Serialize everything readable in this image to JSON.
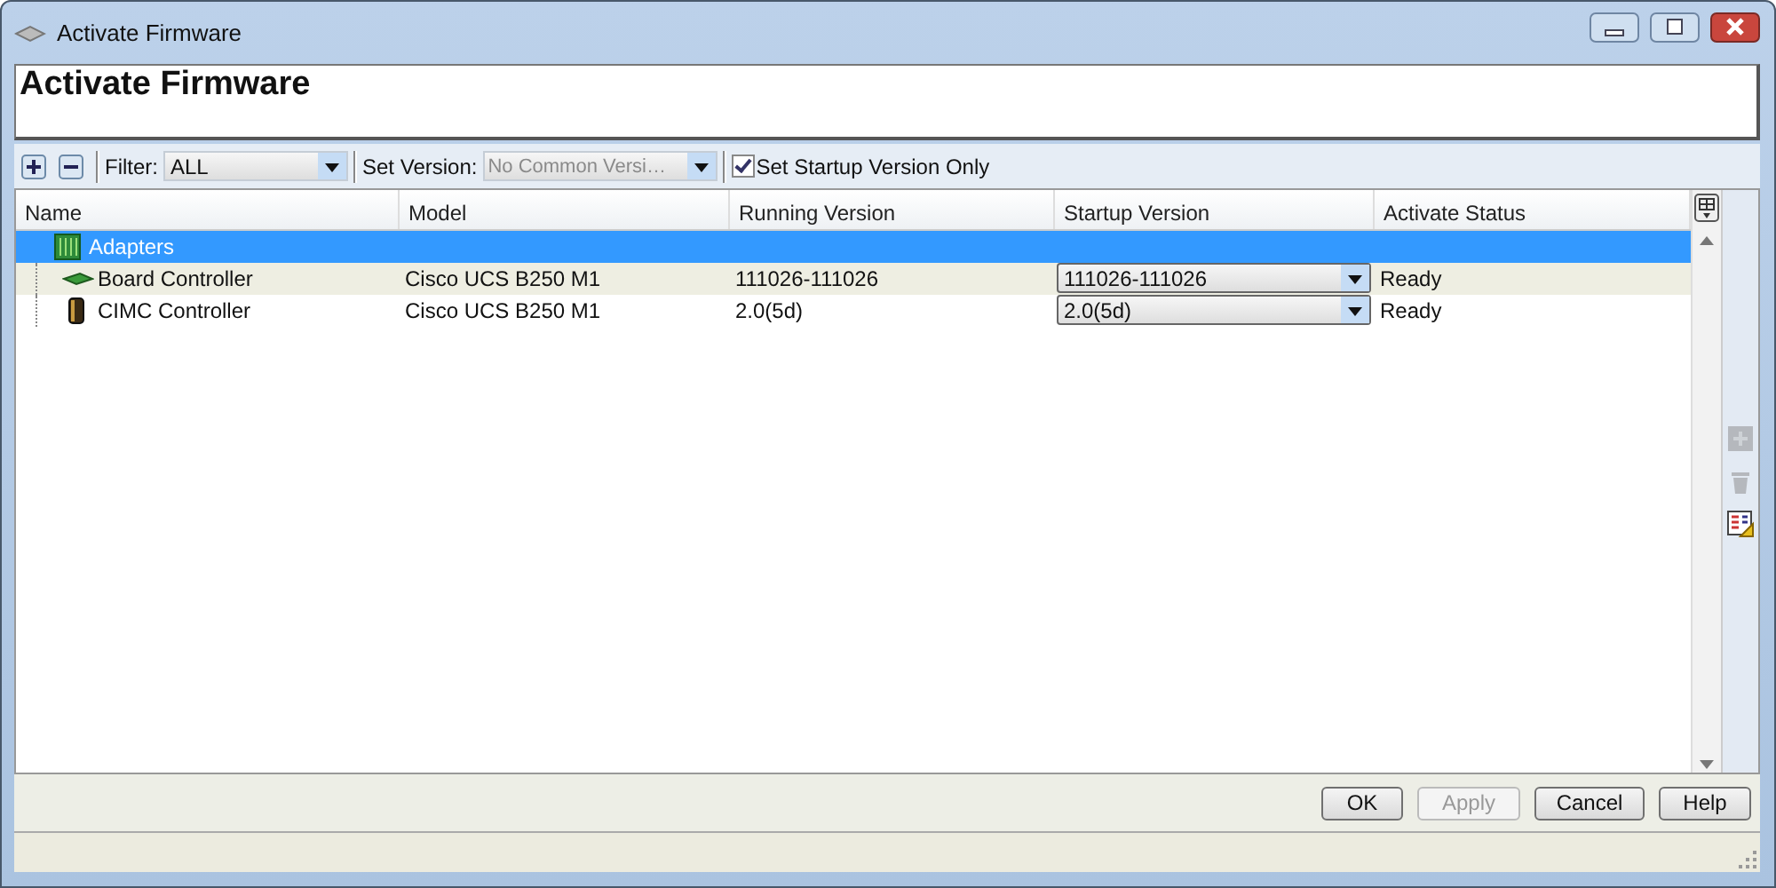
{
  "window": {
    "title": "Activate Firmware"
  },
  "header": {
    "title": "Activate Firmware"
  },
  "toolbar": {
    "filter": {
      "label": "Filter:",
      "value": "ALL"
    },
    "set_version": {
      "label": "Set Version:",
      "value": "No Common Versi…",
      "disabled": true
    },
    "startup_only": {
      "label": "Set Startup Version Only",
      "checked": true
    }
  },
  "table": {
    "columns": [
      "Name",
      "Model",
      "Running Version",
      "Startup Version",
      "Activate Status"
    ],
    "rows": [
      {
        "name": "Adapters",
        "kind": "adapter",
        "selected": true,
        "children": [
          {
            "name": "Board Controller",
            "kind": "board",
            "model": "Cisco UCS B250 M1",
            "running": "111026-111026",
            "startup": "111026-111026",
            "status": "Ready",
            "selected": false
          },
          {
            "name": "CIMC Controller",
            "kind": "chip",
            "model": "Cisco UCS B250 M1",
            "running": "2.0(5d)",
            "startup": "2.0(5d)",
            "status": "Ready",
            "selected": false
          }
        ]
      }
    ]
  },
  "side_tools": [
    {
      "kind": "add",
      "disabled": true
    },
    {
      "kind": "delete",
      "disabled": true
    },
    {
      "kind": "properties",
      "disabled": false
    }
  ],
  "buttons": [
    {
      "label": "OK",
      "disabled": false
    },
    {
      "label": "Apply",
      "disabled": true
    },
    {
      "label": "Cancel",
      "disabled": false
    },
    {
      "label": "Help",
      "disabled": false
    }
  ]
}
